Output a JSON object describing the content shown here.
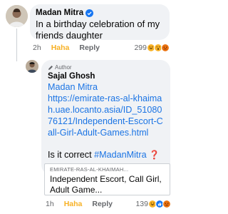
{
  "comment1": {
    "author": "Madan Mitra",
    "text": "In a birthday celebration of my friends daughter",
    "time": "2h",
    "haha_label": "Haha",
    "reply_label": "Reply",
    "reaction_count": "299"
  },
  "comment2": {
    "badge": "Author",
    "author": "Sajal Ghosh",
    "line1": "Madan Mitra",
    "url": "https://emirate-ras-al-khaimah.uae.locanto.asia/ID_5108076121/Independent-Escort-Call-Girl-Adult-Games.html",
    "question": "Is it correct ",
    "hashtag": "#MadanMitra",
    "qmark": "❓",
    "time": "1h",
    "haha_label": "Haha",
    "reply_label": "Reply",
    "reaction_count": "139"
  },
  "preview": {
    "domain": "EMIRATE-RAS-AL-KHAIMAH...",
    "title": "Independent Escort, Call Girl, Adult Game..."
  },
  "colors": {
    "link": "#1b74e4",
    "haha": "#f7b125",
    "bubble": "#f0f2f5",
    "verified": "#1877f2"
  }
}
